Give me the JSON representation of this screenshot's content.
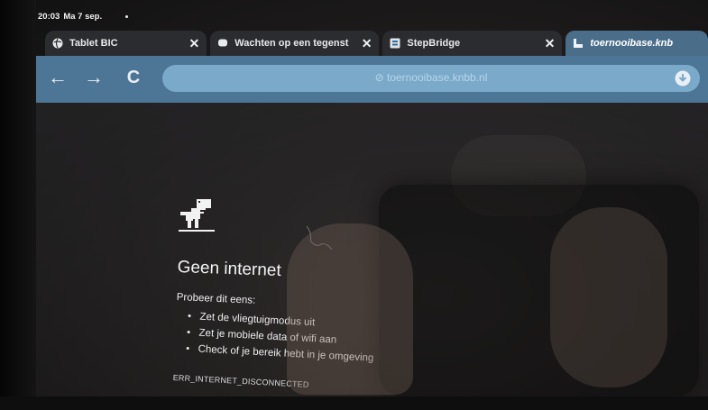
{
  "status_bar": {
    "time": "20:03",
    "date": "Ma 7 sep."
  },
  "tabs": [
    {
      "title": "Tablet BIC",
      "icon": "globe-icon",
      "close": "✕"
    },
    {
      "title": "Wachten op een tegenst",
      "icon": "chat-icon",
      "close": "✕"
    },
    {
      "title": "StepBridge",
      "icon": "stepbridge-icon",
      "close": "✕"
    },
    {
      "title": "toernooibase.knb",
      "icon": "toernooibase-icon",
      "active": true
    }
  ],
  "toolbar": {
    "back": "←",
    "forward": "→",
    "reload": "C",
    "url": "⊘ toernooibase.knbb.nl",
    "download_icon": "download-icon"
  },
  "error_page": {
    "title": "Geen internet",
    "subhead": "Probeer dit eens:",
    "tips": [
      "Zet de vliegtuigmodus uit",
      "Zet je mobiele data of wifi aan",
      "Check of je bereik hebt in je omgeving"
    ],
    "error_code": "ERR_INTERNET_DISCONNECTED"
  },
  "colors": {
    "toolbar": "#4d7696",
    "omnibox": "#7aa9c9",
    "active_tab": "#4a6e8a"
  }
}
